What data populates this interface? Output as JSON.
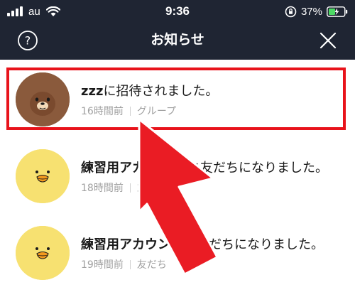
{
  "status_bar": {
    "carrier": "au",
    "time": "9:36",
    "battery": "37%"
  },
  "header": {
    "title": "お知らせ",
    "help_icon": "question-circle-icon",
    "close_icon": "close-icon"
  },
  "notifications": [
    {
      "avatar": "brown-bear",
      "actor": "zzz",
      "message": "に招待されました。",
      "time": "16時間前",
      "category": "グループ"
    },
    {
      "avatar": "sally-chick",
      "actor": "練習用アカ",
      "message": "と友だちになりました。",
      "time": "18時間前",
      "category": "友"
    },
    {
      "avatar": "sally-chick",
      "actor": "練習用アカウント",
      "message": "と友だちになりました。",
      "time": "19時間前",
      "category": "友だち"
    }
  ],
  "colors": {
    "header_bg": "#1f2533",
    "highlight": "#e8131b",
    "arrow": "#ea1c24",
    "sally_yellow": "#f7e171",
    "brown_fur": "#8a5a3c"
  }
}
